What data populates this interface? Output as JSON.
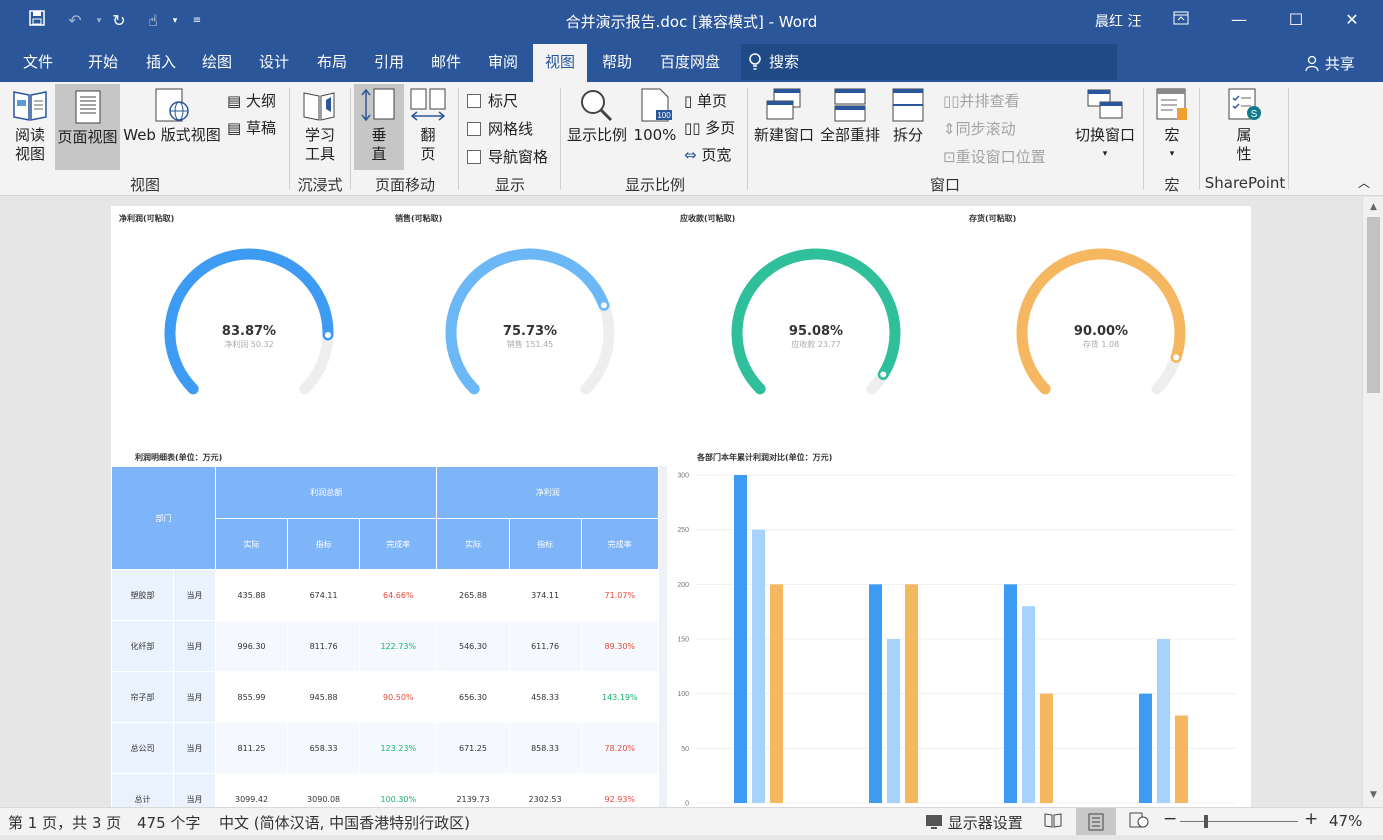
{
  "window": {
    "title": "合并演示报告.doc [兼容模式]  -  Word",
    "user": "晨红 汪"
  },
  "tabs": [
    "文件",
    "开始",
    "插入",
    "绘图",
    "设计",
    "布局",
    "引用",
    "邮件",
    "审阅",
    "视图",
    "帮助",
    "百度网盘"
  ],
  "active_tab": "视图",
  "search_label": "搜索",
  "share_label": "共享",
  "ribbon": {
    "view": {
      "read": "阅读\n视图",
      "page": "页面视图",
      "web": "Web 版式视图",
      "outline": "大纲",
      "draft": "草稿",
      "group": "视图"
    },
    "immersive": {
      "learn": "学习\n工具",
      "group": "沉浸式"
    },
    "movement": {
      "vertical": "垂\n直",
      "flip": "翻\n页",
      "group": "页面移动"
    },
    "show": {
      "ruler": "标尺",
      "grid": "网格线",
      "nav": "导航窗格",
      "group": "显示"
    },
    "zoom": {
      "zoom": "显示比例",
      "hundred": "100%",
      "single": "单页",
      "multi": "多页",
      "width": "页宽",
      "group": "显示比例"
    },
    "window": {
      "new": "新建窗口",
      "arrange": "全部重排",
      "split": "拆分",
      "side": "并排查看",
      "sync": "同步滚动",
      "reset": "重设窗口位置",
      "switch": "切换窗口",
      "group": "窗口"
    },
    "macro": {
      "macro": "宏",
      "group": "宏"
    },
    "sharepoint": {
      "prop": "属\n性",
      "group": "SharePoint"
    }
  },
  "gauges": [
    {
      "title": "净利润(可粘取)",
      "percent": "83.87%",
      "value": 83.87,
      "sub": "净利润 50.32",
      "color": "#3d9bf3"
    },
    {
      "title": "销售(可粘取)",
      "percent": "75.73%",
      "value": 75.73,
      "sub": "销售 151.45",
      "color": "#6cb8f6"
    },
    {
      "title": "应收款(可粘取)",
      "percent": "95.08%",
      "value": 95.08,
      "sub": "应收款 23.77",
      "color": "#2fbf9b"
    },
    {
      "title": "存货(可粘取)",
      "percent": "90.00%",
      "value": 90.0,
      "sub": "存货 1.08",
      "color": "#f5b760"
    }
  ],
  "table": {
    "title": "利润明细表(单位：万元)",
    "head_dept": "部门",
    "group_profit": "利润总额",
    "group_net": "净利润",
    "sub_headers": [
      "实际",
      "指标",
      "完成率",
      "实际",
      "指标",
      "完成率"
    ],
    "rows": [
      {
        "dept": "塑胶部",
        "period": "当月",
        "cells": [
          "435.88",
          "674.11",
          "64.66%",
          "265.88",
          "374.11",
          "71.07%"
        ],
        "flags": [
          "n",
          "n",
          "r",
          "n",
          "n",
          "r"
        ]
      },
      {
        "dept": "化纤部",
        "period": "当月",
        "cells": [
          "996.30",
          "811.76",
          "122.73%",
          "546.30",
          "611.76",
          "89.30%"
        ],
        "flags": [
          "n",
          "n",
          "g",
          "n",
          "n",
          "r"
        ]
      },
      {
        "dept": "帘子部",
        "period": "当月",
        "cells": [
          "855.99",
          "945.88",
          "90.50%",
          "656.30",
          "458.33",
          "143.19%"
        ],
        "flags": [
          "n",
          "n",
          "r",
          "n",
          "n",
          "g"
        ]
      },
      {
        "dept": "总公司",
        "period": "当月",
        "cells": [
          "811.25",
          "658.33",
          "123.23%",
          "671.25",
          "858.33",
          "78.20%"
        ],
        "flags": [
          "n",
          "n",
          "g",
          "n",
          "n",
          "r"
        ]
      },
      {
        "dept": "总计",
        "period": "当月",
        "cells": [
          "3099.42",
          "3090.08",
          "100.30%",
          "2139.73",
          "2302.53",
          "92.93%"
        ],
        "flags": [
          "n",
          "n",
          "g",
          "n",
          "n",
          "r"
        ]
      }
    ]
  },
  "chart_data": {
    "type": "bar",
    "title": "各部门本年累计利润对比(单位：万元)",
    "ylim": [
      0,
      300
    ],
    "yticks": [
      0,
      50,
      100,
      150,
      200,
      250,
      300
    ],
    "categories": [
      "",
      "",
      "",
      ""
    ],
    "series": [
      {
        "values": [
          300,
          200,
          200,
          100
        ],
        "color": "#3d9bf3"
      },
      {
        "values": [
          250,
          150,
          180,
          150
        ],
        "color": "#a6d3fb"
      },
      {
        "values": [
          200,
          200,
          100,
          80
        ],
        "color": "#f5b760"
      }
    ]
  },
  "status": {
    "page": "第 1 页，共 3 页",
    "words": "475 个字",
    "lang": "中文 (简体汉语, 中国香港特别行政区)",
    "display": "显示器设置",
    "zoom": "47%"
  }
}
